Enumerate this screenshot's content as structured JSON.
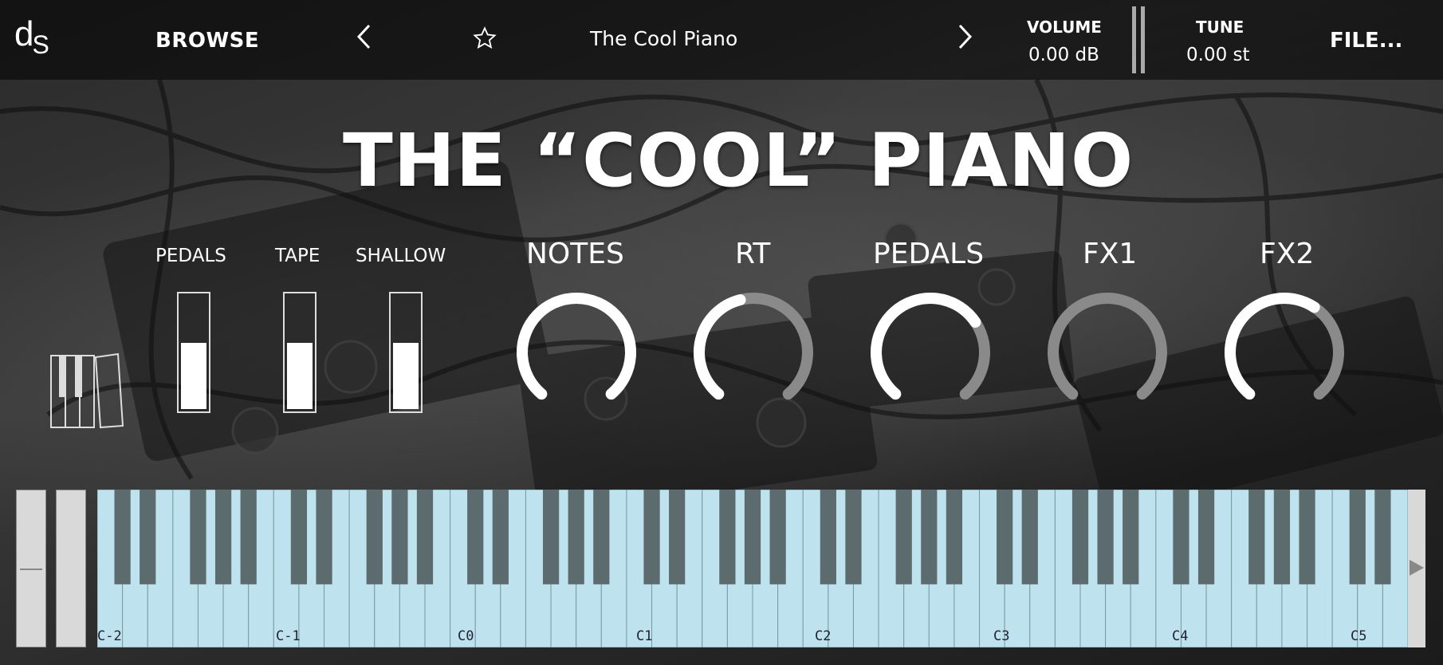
{
  "header": {
    "logo_main": "d",
    "logo_sub": "S",
    "browse_label": "BROWSE",
    "prev_icon": "chevron-left",
    "next_icon": "chevron-right",
    "favorite_icon": "star-outline",
    "preset_name": "The Cool Piano",
    "volume_label": "VOLUME",
    "volume_value": "0.00 dB",
    "tune_label": "TUNE",
    "tune_value": "0.00 st",
    "file_label": "FILE..."
  },
  "main": {
    "title": "THE “COOL” PIANO",
    "sliders": [
      {
        "label": "PEDALS",
        "level": 0.6
      },
      {
        "label": "TAPE",
        "level": 0.6
      },
      {
        "label": "SHALLOW",
        "level": 0.6
      }
    ],
    "knobs": [
      {
        "label": "NOTES",
        "value": 1.0
      },
      {
        "label": "RT",
        "value": 0.45
      },
      {
        "label": "PEDALS",
        "value": 0.7
      },
      {
        "label": "FX1",
        "value": 0.0
      },
      {
        "label": "FX2",
        "value": 0.62
      }
    ]
  },
  "keyboard": {
    "octave_labels": [
      "C-2",
      "C-1",
      "C0",
      "C1",
      "C2",
      "C3",
      "C4",
      "C5"
    ],
    "key_color": "#bfe3ee",
    "black_key_color": "#5c6b6e"
  },
  "colors": {
    "accent": "#ffffff",
    "arc_track": "#8a8a8a"
  }
}
